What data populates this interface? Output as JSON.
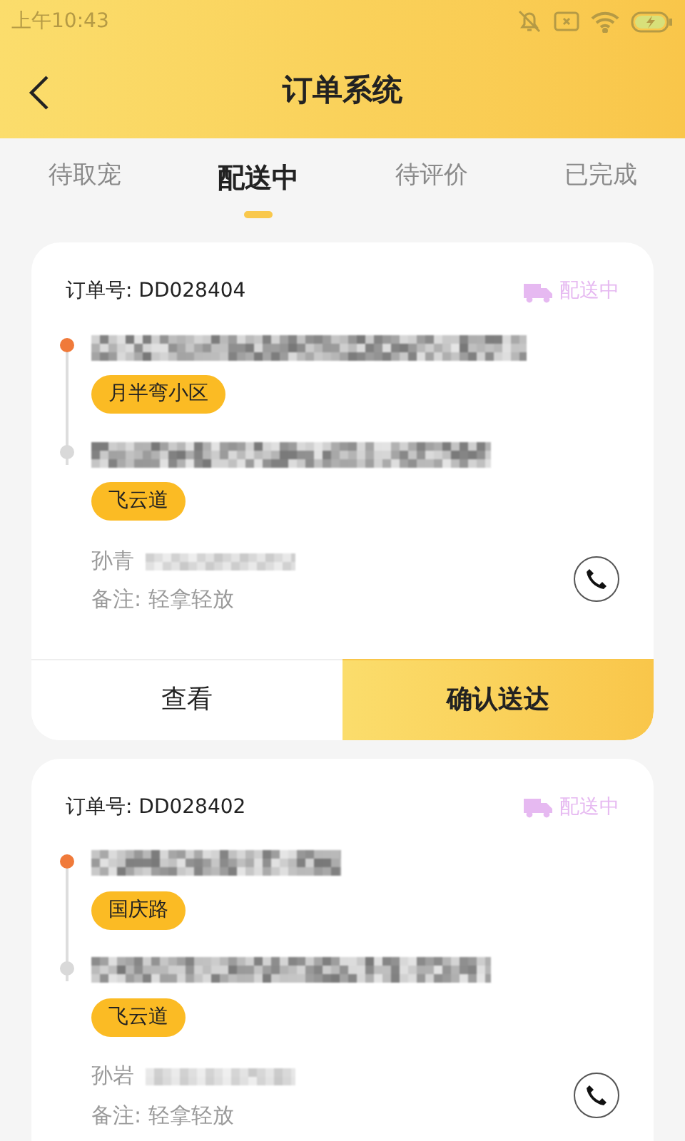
{
  "status_bar": {
    "time": "上午10:43"
  },
  "header": {
    "title": "订单系统"
  },
  "tabs": [
    {
      "label": "待取宠",
      "selected": false
    },
    {
      "label": "配送中",
      "selected": true
    },
    {
      "label": "待评价",
      "selected": false
    },
    {
      "label": "已完成",
      "selected": false
    }
  ],
  "orders": [
    {
      "order_no": "订单号: DD028404",
      "status": "配送中",
      "stops": [
        {
          "tag": "月半弯小区",
          "color": "#f07a3a"
        },
        {
          "tag": "飞云道",
          "color": "#d9d9d9"
        }
      ],
      "contact": "孙青",
      "note": "备注: 轻拿轻放",
      "actions": [
        {
          "label": "查看",
          "kind": "plain"
        },
        {
          "label": "确认送达",
          "kind": "primary"
        }
      ]
    },
    {
      "order_no": "订单号: DD028402",
      "status": "配送中",
      "stops": [
        {
          "tag": "国庆路",
          "color": "#f07a3a"
        },
        {
          "tag": "飞云道",
          "color": "#d9d9d9"
        }
      ],
      "contact": "孙岩",
      "note": "备注: 轻拿轻放"
    }
  ]
}
